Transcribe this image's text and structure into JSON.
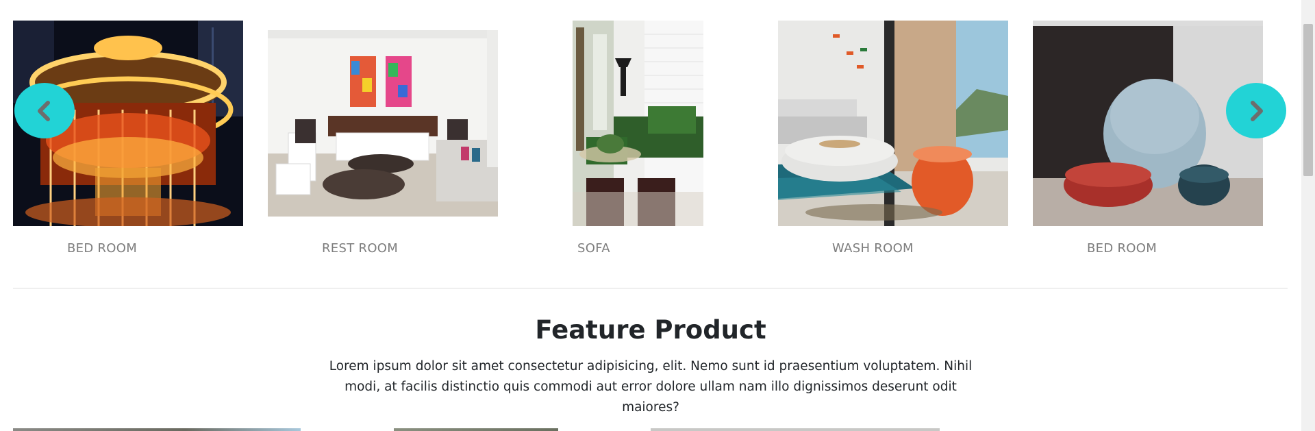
{
  "carousel": {
    "prev_icon": "chevron-left-icon",
    "next_icon": "chevron-right-icon",
    "accent_color": "#22d3d6",
    "slides": [
      {
        "label": "BED ROOM",
        "image": "carousel-at-night"
      },
      {
        "label": "REST ROOM",
        "image": "white-living-room"
      },
      {
        "label": "SOFA",
        "image": "green-sofa-room"
      },
      {
        "label": "WASH ROOM",
        "image": "lounge-with-orange-stool"
      },
      {
        "label": "BED ROOM",
        "image": "pastel-poufs"
      }
    ]
  },
  "feature": {
    "title": "Feature Product",
    "description": "Lorem ipsum dolor sit amet consectetur adipisicing, elit. Nemo sunt id praesentium voluptatem. Nihil modi, at facilis distinctio quis commodi aut error dolore ullam nam illo dignissimos deserunt odit maiores?"
  }
}
